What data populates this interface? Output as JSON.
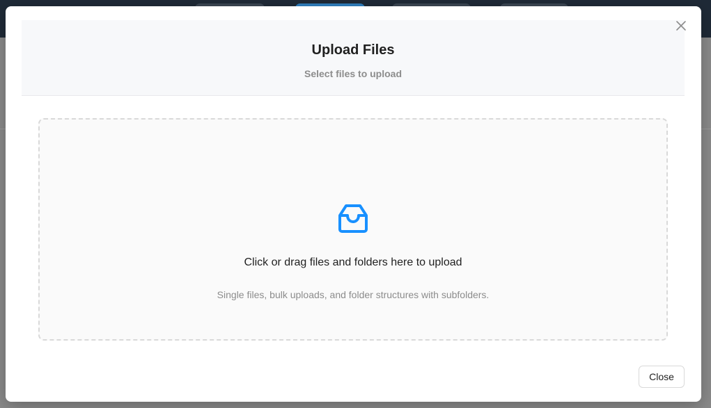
{
  "modal": {
    "title": "Upload Files",
    "subtitle": "Select files to upload",
    "close_icon": "close-icon"
  },
  "dropzone": {
    "icon": "inbox-icon",
    "text": "Click or drag files and folders here to upload",
    "hint": "Single files, bulk uploads, and folder structures with subfolders.",
    "accent_color": "#1890ff"
  },
  "footer": {
    "close_label": "Close"
  }
}
